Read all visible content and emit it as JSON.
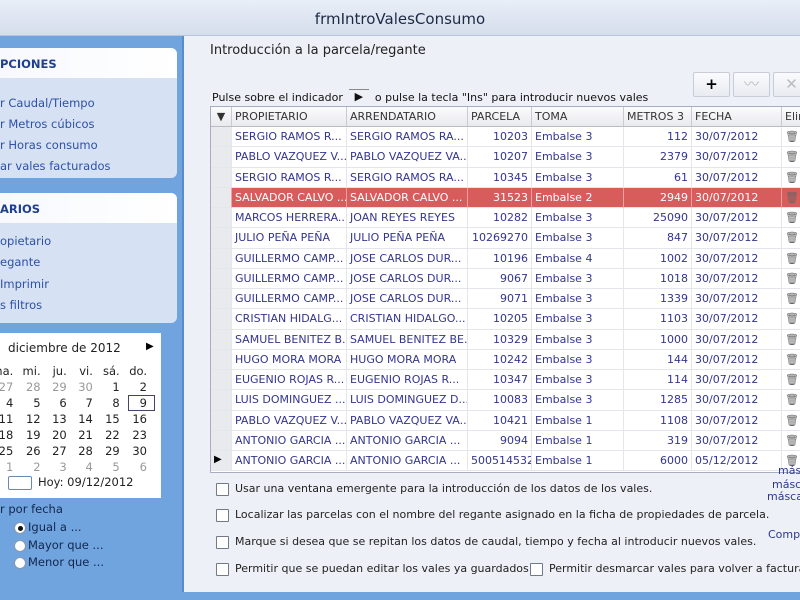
{
  "window": {
    "title": "frmIntroValesConsumo"
  },
  "sidebar": {
    "options": {
      "header": "PCIONES",
      "items": [
        "r Caudal/Tiempo",
        "r Metros cúbicos",
        "r Horas consumo",
        "ar vales facturados"
      ]
    },
    "listings": {
      "header": "ARIOS",
      "items": [
        "opietario",
        "egante",
        "Imprimir",
        "s filtros"
      ]
    },
    "calendar": {
      "month": "diciembre de 2012",
      "weekdays": [
        "na.",
        "mi.",
        "ju.",
        "vi.",
        "sá.",
        "do."
      ],
      "weeks": [
        [
          "27",
          "28",
          "29",
          "30",
          "1",
          "2"
        ],
        [
          "4",
          "5",
          "6",
          "7",
          "8",
          "9"
        ],
        [
          "11",
          "12",
          "13",
          "14",
          "15",
          "16"
        ],
        [
          "18",
          "19",
          "20",
          "21",
          "22",
          "23"
        ],
        [
          "25",
          "26",
          "27",
          "28",
          "29",
          "30"
        ],
        [
          "1",
          "2",
          "3",
          "4",
          "5",
          "6"
        ]
      ],
      "selected_day": "9",
      "today_label": "Hoy: 09/12/2012"
    },
    "filter": {
      "label": "r por fecha",
      "options": [
        "Igual a ...",
        "Mayor que ...",
        "Menor que ..."
      ],
      "selected": 0
    }
  },
  "main": {
    "title": "Introducción a la parcela/regante",
    "hint_before": "Pulse sobre el indicador",
    "hint_after": "o pulse la tecla \"Ins\" para introducir nuevos vales",
    "toolbar": {
      "add": "+",
      "edit": "〰",
      "delete": "✕"
    },
    "columns": [
      "PROPIETARIO",
      "ARRENDATARIO",
      "PARCELA",
      "TOMA",
      "METROS 3",
      "FECHA",
      "Elim"
    ],
    "rows": [
      [
        "SERGIO RAMOS R...",
        "SERGIO RAMOS RA...",
        "10203",
        "Embalse 3",
        "112",
        "30/07/2012"
      ],
      [
        "PABLO VAZQUEZ V...",
        "PABLO VAZQUEZ VA...",
        "10207",
        "Embalse 3",
        "2379",
        "30/07/2012"
      ],
      [
        "SERGIO RAMOS R...",
        "SERGIO RAMOS RA...",
        "10345",
        "Embalse 3",
        "61",
        "30/07/2012"
      ],
      [
        "SALVADOR CALVO ...",
        "SALVADOR CALVO ...",
        "31523",
        "Embalse 2",
        "2949",
        "30/07/2012"
      ],
      [
        "MARCOS HERRERA...",
        "JOAN REYES REYES",
        "10282",
        "Embalse 3",
        "25090",
        "30/07/2012"
      ],
      [
        "JULIO PEÑA PEÑA",
        "JULIO PEÑA PEÑA",
        "10269270",
        "Embalse 3",
        "847",
        "30/07/2012"
      ],
      [
        "GUILLERMO CAMP...",
        "JOSE CARLOS DUR...",
        "10196",
        "Embalse 4",
        "1002",
        "30/07/2012"
      ],
      [
        "GUILLERMO CAMP...",
        "JOSE CARLOS DUR...",
        "9067",
        "Embalse 3",
        "1018",
        "30/07/2012"
      ],
      [
        "GUILLERMO CAMP...",
        "JOSE CARLOS DUR...",
        "9071",
        "Embalse 3",
        "1339",
        "30/07/2012"
      ],
      [
        "CRISTIAN HIDALG...",
        "CRISTIAN HIDALGO...",
        "10205",
        "Embalse 3",
        "1103",
        "30/07/2012"
      ],
      [
        "SAMUEL BENITEZ B...",
        "SAMUEL BENITEZ BE...",
        "10329",
        "Embalse 3",
        "1000",
        "30/07/2012"
      ],
      [
        "HUGO MORA MORA",
        "HUGO MORA MORA",
        "10242",
        "Embalse 3",
        "144",
        "30/07/2012"
      ],
      [
        "EUGENIO ROJAS R...",
        "EUGENIO ROJAS R...",
        "10347",
        "Embalse 3",
        "114",
        "30/07/2012"
      ],
      [
        "LUIS DOMINGUEZ ...",
        "LUIS DOMINGUEZ D...",
        "10083",
        "Embalse 3",
        "1285",
        "30/07/2012"
      ],
      [
        "PABLO VAZQUEZ V...",
        "PABLO VAZQUEZ VA...",
        "10421",
        "Embalse 1",
        "1108",
        "30/07/2012"
      ],
      [
        "ANTONIO GARCIA ...",
        "ANTONIO GARCIA ...",
        "9094",
        "Embalse 1",
        "319",
        "30/07/2012"
      ],
      [
        "ANTONIO GARCIA ...",
        "ANTONIO GARCIA ...",
        "500514532",
        "Embalse 1",
        "6000",
        "05/12/2012"
      ]
    ],
    "highlighted_row": 3,
    "current_row": 16,
    "highlight_color": "#d85c5c",
    "checkboxes": [
      "Usar una ventana emergente para la introducción de los datos de los vales.",
      "Localizar las parcelas con el nombre del regante asignado en la ficha de propiedades de parcela.",
      "Marque si desea que se repitan los datos de caudal, tiempo y fecha al introducir nuevos vales.",
      "Permitir que se puedan editar los vales ya guardados",
      "Permitir desmarcar vales para volver a facturarlos"
    ],
    "side_notes": [
      "más",
      "máscar",
      "máscar",
      "Compr"
    ]
  }
}
